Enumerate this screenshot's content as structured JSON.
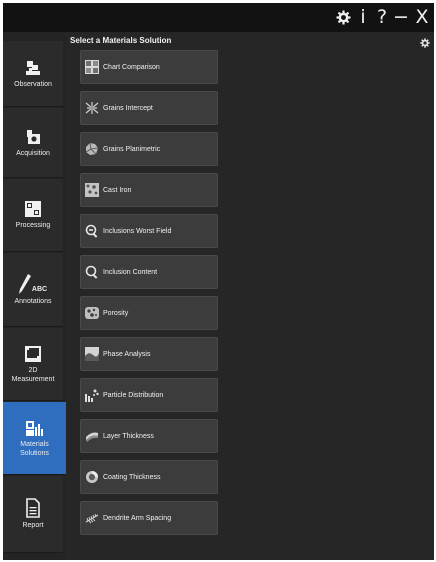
{
  "titlebar": {
    "settings_icon": "gear-icon",
    "info_label": "i",
    "help_label": "?",
    "minimize_label": "−",
    "close_label": "X"
  },
  "sidebar": {
    "accent_color": "#2f6dbe",
    "items": [
      {
        "label": "Observation",
        "icon": "microscope-icon",
        "active": false
      },
      {
        "label": "Acquisition",
        "icon": "camera-icon",
        "active": false
      },
      {
        "label": "Processing",
        "icon": "processing-grid-icon",
        "active": false
      },
      {
        "label": "Annotations",
        "icon": "annotation-pen-icon",
        "icon_text": "ABC",
        "active": false
      },
      {
        "label": "2D\nMeasurement",
        "label_line1": "2D",
        "label_line2": "Measurement",
        "icon": "measurement-icon",
        "active": false
      },
      {
        "label": "Materials\nSolutions",
        "label_line1": "Materials",
        "label_line2": "Solutions",
        "icon": "materials-chart-icon",
        "active": true
      },
      {
        "label": "Report",
        "icon": "document-icon",
        "active": false
      }
    ]
  },
  "main": {
    "title": "Select a Materials Solution",
    "settings_icon": "gear-icon",
    "solutions": [
      {
        "label": "Chart Comparison",
        "icon": "chart-comparison-icon"
      },
      {
        "label": "Grains Intercept",
        "icon": "grains-intercept-icon"
      },
      {
        "label": "Grains Planimetric",
        "icon": "grains-planimetric-icon"
      },
      {
        "label": "Cast Iron",
        "icon": "cast-iron-icon"
      },
      {
        "label": "Inclusions Worst Field",
        "icon": "inclusions-worst-field-icon"
      },
      {
        "label": "Inclusion Content",
        "icon": "inclusion-content-icon"
      },
      {
        "label": "Porosity",
        "icon": "porosity-icon"
      },
      {
        "label": "Phase Analysis",
        "icon": "phase-analysis-icon"
      },
      {
        "label": "Particle Distribution",
        "icon": "particle-distribution-icon"
      },
      {
        "label": "Layer Thickness",
        "icon": "layer-thickness-icon"
      },
      {
        "label": "Coating Thickness",
        "icon": "coating-thickness-icon"
      },
      {
        "label": "Dendrite Arm Spacing",
        "icon": "dendrite-arm-spacing-icon"
      }
    ]
  }
}
